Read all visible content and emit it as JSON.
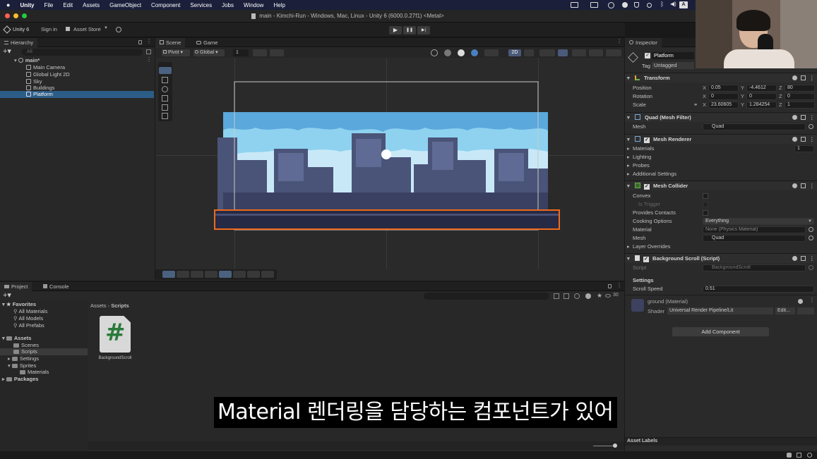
{
  "menubar": {
    "app": "Unity",
    "items": [
      "File",
      "Edit",
      "Assets",
      "GameObject",
      "Component",
      "Services",
      "Jobs",
      "Window",
      "Help"
    ],
    "keyboard_indicator": "A"
  },
  "window": {
    "title": "main - Kimchi-Run - Windows, Mac, Linux - Unity 6 (6000.0.27f1) <Metal>"
  },
  "toolbar": {
    "unity_label": "Unity 6",
    "sign_in": "Sign in",
    "asset_store": "Asset Store",
    "play": "▶",
    "pause": "❚❚",
    "step": "▶|"
  },
  "hierarchy": {
    "tab": "Hierarchy",
    "search_placeholder": "All",
    "scene": "main*",
    "items": [
      "Main Camera",
      "Global Light 2D",
      "Sky",
      "Buildings",
      "Platform"
    ],
    "selected": "Platform"
  },
  "scene_view": {
    "tabs": [
      "Scene",
      "Game"
    ],
    "pivot": "Pivot",
    "global": "Global",
    "layer_num": "1",
    "mode_2d": "2D"
  },
  "project": {
    "tabs": [
      "Project",
      "Console"
    ],
    "count": "30",
    "breadcrumb": [
      "Assets",
      "Scripts"
    ],
    "favorites_label": "Favorites",
    "favorites": [
      "All Materials",
      "All Models",
      "All Prefabs"
    ],
    "assets_label": "Assets",
    "asset_folders": [
      "Scenes",
      "Scripts",
      "Settings",
      "Sprites"
    ],
    "sprites_sub": "Materials",
    "packages_label": "Packages",
    "file": {
      "name": "BackgroundScroll",
      "glyph": "#"
    }
  },
  "inspector": {
    "tab": "Inspector",
    "object_name": "Platform",
    "tag_label": "Tag",
    "tag_value": "Untagged",
    "transform": {
      "title": "Transform",
      "position": {
        "label": "Position",
        "x": "0.05",
        "y": "-4.4612",
        "z": "80"
      },
      "rotation": {
        "label": "Rotation",
        "x": "0",
        "y": "0",
        "z": "0"
      },
      "scale": {
        "label": "Scale",
        "x": "23.60605",
        "y": "1.284254",
        "z": "1"
      }
    },
    "mesh_filter": {
      "title": "Quad (Mesh Filter)",
      "mesh_label": "Mesh",
      "mesh_value": "Quad"
    },
    "mesh_renderer": {
      "title": "Mesh Renderer",
      "materials": "Materials",
      "materials_count": "1",
      "lighting": "Lighting",
      "probes": "Probes",
      "additional": "Additional Settings"
    },
    "mesh_collider": {
      "title": "Mesh Collider",
      "convex": "Convex",
      "is_trigger": "Is Trigger",
      "provides_contacts": "Provides Contacts",
      "cooking_label": "Cooking Options",
      "cooking_value": "Everything",
      "material_label": "Material",
      "material_value": "None (Physics Material)",
      "mesh_label": "Mesh",
      "mesh_value": "Quad",
      "layer_overrides": "Layer Overrides"
    },
    "bg_scroll": {
      "title": "Background Scroll (Script)",
      "script_label": "Script",
      "script_value": "BackgroundScroll",
      "settings": "Settings",
      "speed_label": "Scroll Speed",
      "speed_value": "0.51"
    },
    "material": {
      "name": "ground (Material)",
      "shader_label": "Shader",
      "shader_value": "Universal Render Pipeline/Lit",
      "edit": "Edit..."
    },
    "add_component": "Add Component",
    "asset_labels": "Asset Labels"
  },
  "subtitle": "Material 렌더링을 담당하는 컴포넌트가 있어"
}
